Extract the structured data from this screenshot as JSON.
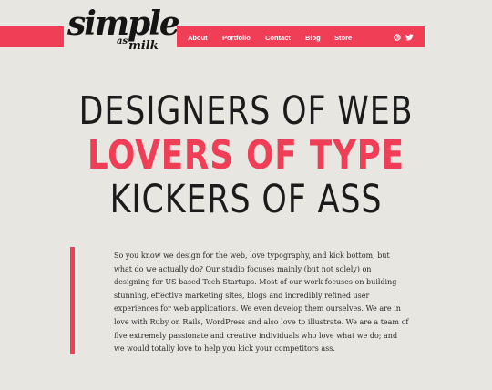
{
  "brand": {
    "logo_main": "simple",
    "logo_as": "as",
    "logo_sub": "milk",
    "accent_color": "#ef3e56",
    "background_color": "#e8e6e1"
  },
  "nav": {
    "items": [
      {
        "label": "About"
      },
      {
        "label": "Portfolio"
      },
      {
        "label": "Contact"
      },
      {
        "label": "Blog"
      },
      {
        "label": "Store"
      }
    ],
    "icons": [
      "dribbble-icon",
      "twitter-icon"
    ]
  },
  "hero": {
    "line1": "DESIGNERS OF WEB",
    "line2": "LOVERS OF TYPE",
    "line3": "KICKERS OF ASS"
  },
  "intro": {
    "text": "So you know we design for the web, love typography, and kick bottom, but\nwhat do we actually do? Our studio focuses mainly (but not solely) on\ndesigning for US based Tech-Startups. Most of our work focuses on building\nstunning, effective marketing sites, blogs and incredibly refined user\nexperiences for web applications. We even develop them ourselves. We are in\nlove with Ruby on Rails, WordPress and also love to illustrate. We are a team of\nfive extremely passionate and creative individuals who love what we do; and\nwe would totally love to help you kick your competitors ass."
  }
}
